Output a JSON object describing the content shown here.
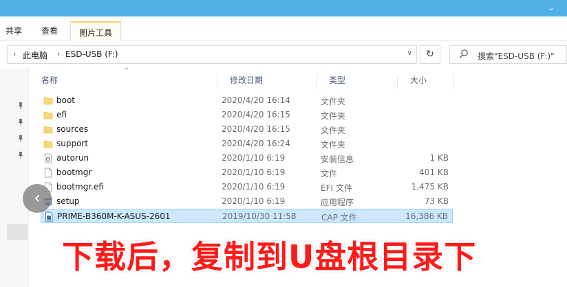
{
  "ribbon": {
    "tabs": [
      "共享",
      "查看",
      "图片工具"
    ]
  },
  "address": {
    "crumbs": [
      "此电脑",
      "ESD-USB (F:)"
    ],
    "search_placeholder": "搜索\"ESD-USB (F:)\""
  },
  "columns": {
    "name": "名称",
    "date": "修改日期",
    "type": "类型",
    "size": "大小"
  },
  "files": [
    {
      "name": "boot",
      "date": "2020/4/20 16:14",
      "type": "文件夹",
      "size": "",
      "icon": "folder-icon"
    },
    {
      "name": "efi",
      "date": "2020/4/20 16:15",
      "type": "文件夹",
      "size": "",
      "icon": "folder-icon"
    },
    {
      "name": "sources",
      "date": "2020/4/20 16:15",
      "type": "文件夹",
      "size": "",
      "icon": "folder-icon"
    },
    {
      "name": "support",
      "date": "2020/4/20 16:24",
      "type": "文件夹",
      "size": "",
      "icon": "folder-icon"
    },
    {
      "name": "autorun",
      "date": "2020/1/10 6:19",
      "type": "安装信息",
      "size": "1 KB",
      "icon": "setup-info-icon"
    },
    {
      "name": "bootmgr",
      "date": "2020/1/10 6:19",
      "type": "文件",
      "size": "401 KB",
      "icon": "file-icon"
    },
    {
      "name": "bootmgr.efi",
      "date": "2020/1/10 6:19",
      "type": "EFI 文件",
      "size": "1,475 KB",
      "icon": "file-icon"
    },
    {
      "name": "setup",
      "date": "2020/1/10 6:19",
      "type": "应用程序",
      "size": "73 KB",
      "icon": "setup-app-icon"
    },
    {
      "name": "PRIME-B360M-K-ASUS-2601",
      "date": "2019/10/30 11:58",
      "type": "CAP 文件",
      "size": "16,386 KB",
      "icon": "cap-file-icon",
      "selected": true
    }
  ],
  "caption": "下载后，复制到U盘根目录下",
  "colors": {
    "titlebar": "#4fb0e6",
    "selection": "#cce8ff",
    "folder": "#f8d775",
    "caption": "#ff1a1a"
  }
}
